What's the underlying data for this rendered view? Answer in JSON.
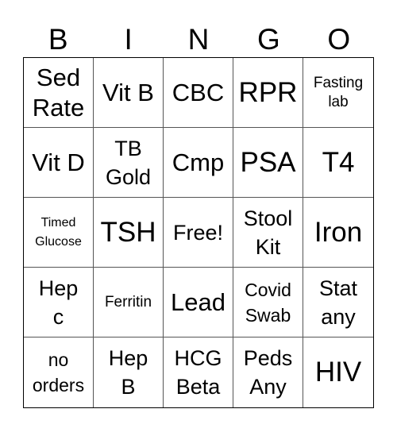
{
  "header": {
    "letters": [
      "B",
      "I",
      "N",
      "G",
      "O"
    ]
  },
  "grid": {
    "rows": [
      [
        "Sed\nRate",
        "Vit B",
        "CBC",
        "RPR",
        "Fasting\nlab"
      ],
      [
        "Vit D",
        "TB\nGold",
        "Cmp",
        "PSA",
        "T4"
      ],
      [
        "Timed\nGlucose",
        "TSH",
        "Free!",
        "Stool\nKit",
        "Iron"
      ],
      [
        "Hep\nc",
        "Ferritin",
        "Lead",
        "Covid\nSwab",
        "Stat\nany"
      ],
      [
        "no\norders",
        "Hep\nB",
        "HCG\nBeta",
        "Peds\nAny",
        "HIV"
      ]
    ]
  }
}
